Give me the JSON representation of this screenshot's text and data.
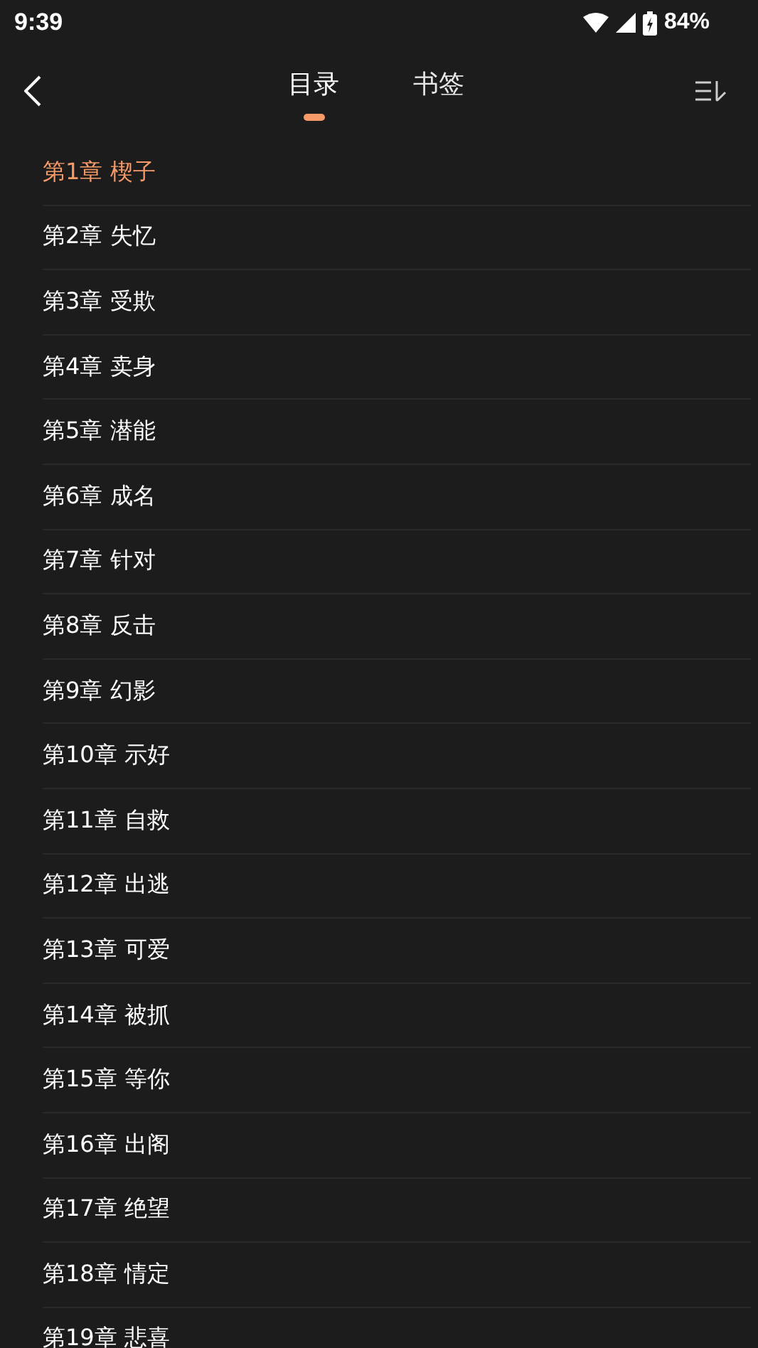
{
  "status_bar": {
    "time": "9:39",
    "battery": "84%"
  },
  "tabs": [
    {
      "label": "目录",
      "selected": true
    },
    {
      "label": "书签",
      "selected": false
    }
  ],
  "chapters": [
    {
      "title": "第1章 楔子",
      "selected": true
    },
    {
      "title": "第2章 失忆",
      "selected": false
    },
    {
      "title": "第3章 受欺",
      "selected": false
    },
    {
      "title": "第4章 卖身",
      "selected": false
    },
    {
      "title": "第5章 潜能",
      "selected": false
    },
    {
      "title": "第6章 成名",
      "selected": false
    },
    {
      "title": "第7章 针对",
      "selected": false
    },
    {
      "title": "第8章 反击",
      "selected": false
    },
    {
      "title": "第9章 幻影",
      "selected": false
    },
    {
      "title": "第10章 示好",
      "selected": false
    },
    {
      "title": "第11章 自救",
      "selected": false
    },
    {
      "title": "第12章 出逃",
      "selected": false
    },
    {
      "title": "第13章 可爱",
      "selected": false
    },
    {
      "title": "第14章 被抓",
      "selected": false
    },
    {
      "title": "第15章 等你",
      "selected": false
    },
    {
      "title": "第16章 出阁",
      "selected": false
    },
    {
      "title": "第17章 绝望",
      "selected": false
    },
    {
      "title": "第18章 情定",
      "selected": false
    },
    {
      "title": "第19章 悲喜",
      "selected": false
    }
  ]
}
